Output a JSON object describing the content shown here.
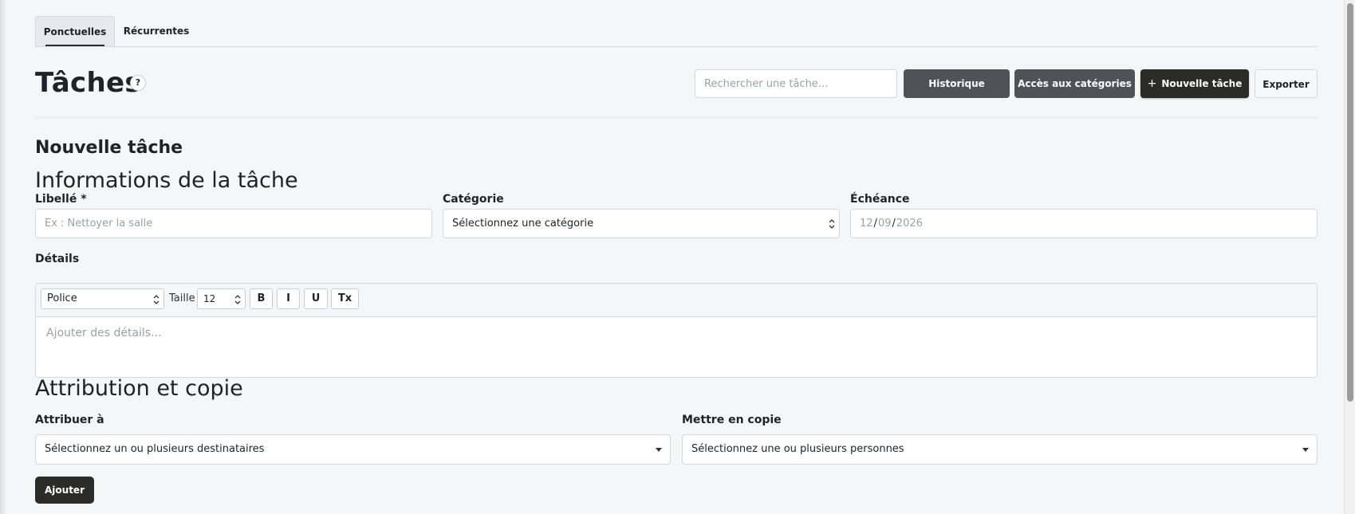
{
  "tabs": [
    {
      "label": "Ponctuelles",
      "active": true
    },
    {
      "label": "Récurrentes",
      "active": false
    }
  ],
  "header": {
    "title": "Tâches",
    "help_label": "?",
    "search_placeholder": "Rechercher une tâche...",
    "buttons": {
      "history": "Historique",
      "categories": "Accès aux catégories",
      "new_task": "Nouvelle tâche",
      "export": "Exporter"
    }
  },
  "form": {
    "heading": "Nouvelle tâche",
    "section_info": "Informations de la tâche",
    "libelle": {
      "label": "Libellé *",
      "placeholder": "Ex : Nettoyer la salle"
    },
    "categorie": {
      "label": "Catégorie",
      "value": "Sélectionnez une catégorie"
    },
    "echeance": {
      "label": "Échéance",
      "day": "12",
      "month": "09",
      "year": "2026"
    },
    "details": {
      "label": "Détails",
      "font_value": "Police",
      "size_label": "Taille",
      "size_value": "12",
      "bold": "B",
      "italic": "I",
      "underline": "U",
      "clear": "Tx",
      "placeholder": "Ajouter des détails..."
    },
    "section_attr": "Attribution et copie",
    "attribuer": {
      "label": "Attribuer à",
      "value": "Sélectionnez un ou plusieurs destinataires"
    },
    "copie": {
      "label": "Mettre en copie",
      "value": "Sélectionnez une ou plusieurs personnes"
    },
    "submit": "Ajouter"
  },
  "colors": {
    "primary_dark": "#2b2c28",
    "secondary": "#4f5357",
    "background": "#f4f6f8"
  }
}
